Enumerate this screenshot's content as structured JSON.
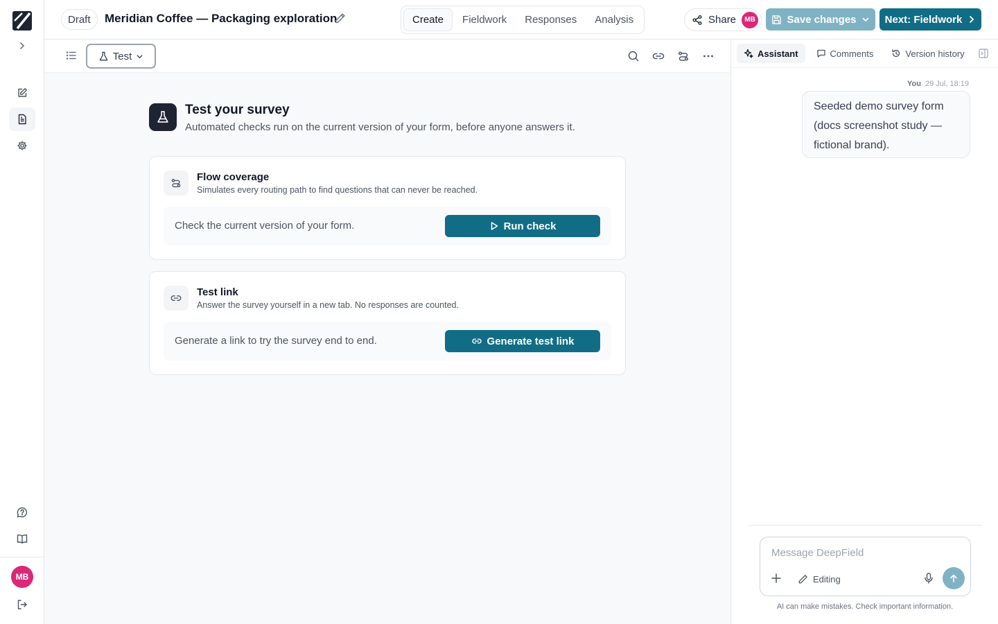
{
  "header": {
    "status": "Draft",
    "title": "Meridian Coffee — Packaging exploration",
    "tabs": [
      {
        "label": "Create",
        "active": true
      },
      {
        "label": "Fieldwork",
        "active": false
      },
      {
        "label": "Responses",
        "active": false
      },
      {
        "label": "Analysis",
        "active": false
      }
    ],
    "share_label": "Share",
    "user_initials": "MB",
    "save_label": "Save changes",
    "next_label": "Next: Fieldwork"
  },
  "toolbar": {
    "mode_label": "Test"
  },
  "main": {
    "title": "Test your survey",
    "subtitle": "Automated checks run on the current version of your form, before anyone answers it.",
    "cards": [
      {
        "title": "Flow coverage",
        "description": "Simulates every routing path to find questions that can never be reached.",
        "prompt": "Check the current version of your form.",
        "action_label": "Run check",
        "icon": "route-icon"
      },
      {
        "title": "Test link",
        "description": "Answer the survey yourself in a new tab. No responses are counted.",
        "prompt": "Generate a link to try the survey end to end.",
        "action_label": "Generate test link",
        "icon": "link-icon"
      }
    ]
  },
  "panel": {
    "tabs": [
      {
        "label": "Assistant",
        "active": true
      },
      {
        "label": "Comments",
        "active": false
      },
      {
        "label": "Version history",
        "active": false
      }
    ],
    "message": {
      "author": "You",
      "time": "29 Jul, 18:19",
      "text": "Seeded demo survey form (docs screenshot study — fictional brand)."
    },
    "composer_placeholder": "Message DeepField",
    "composer_mode": "Editing",
    "disclaimer": "AI can make mistakes. Check important information."
  },
  "rail": {
    "user_initials": "MB"
  },
  "colors": {
    "accent": "#116d86",
    "accent_muted": "#7fb3c3",
    "avatar": "#db2777"
  }
}
